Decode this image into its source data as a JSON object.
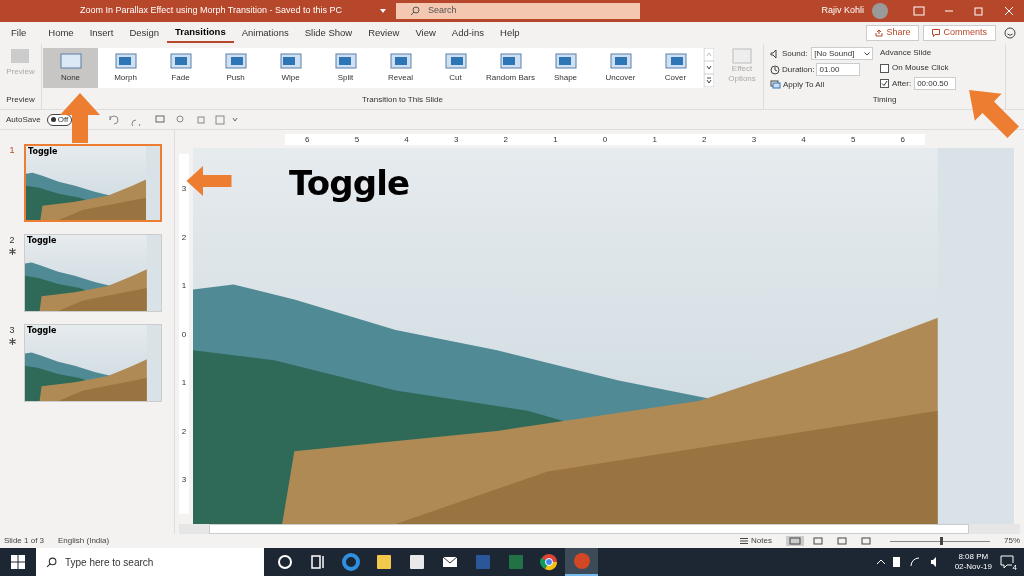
{
  "title_bar": {
    "document_title": "Zoom In Parallax Effect using Morph Transition  -  Saved to this PC",
    "search_placeholder": "Search",
    "user": "Rajiv Kohli"
  },
  "menu_tabs": [
    {
      "label": "File",
      "selected": false
    },
    {
      "label": "Home",
      "selected": false
    },
    {
      "label": "Insert",
      "selected": false
    },
    {
      "label": "Design",
      "selected": false
    },
    {
      "label": "Transitions",
      "selected": true
    },
    {
      "label": "Animations",
      "selected": false
    },
    {
      "label": "Slide Show",
      "selected": false
    },
    {
      "label": "Review",
      "selected": false
    },
    {
      "label": "View",
      "selected": false
    },
    {
      "label": "Add-ins",
      "selected": false
    },
    {
      "label": "Help",
      "selected": false
    }
  ],
  "share": "Share",
  "comments": "Comments",
  "ribbon": {
    "preview": {
      "label": "Preview",
      "disabled": true
    },
    "preview_group": "Preview",
    "transition_group": "Transition to This Slide",
    "transitions": [
      {
        "label": "None",
        "selected": true
      },
      {
        "label": "Morph",
        "selected": false
      },
      {
        "label": "Fade",
        "selected": false
      },
      {
        "label": "Push",
        "selected": false
      },
      {
        "label": "Wipe",
        "selected": false
      },
      {
        "label": "Split",
        "selected": false
      },
      {
        "label": "Reveal",
        "selected": false
      },
      {
        "label": "Cut",
        "selected": false
      },
      {
        "label": "Random Bars",
        "selected": false
      },
      {
        "label": "Shape",
        "selected": false
      },
      {
        "label": "Uncover",
        "selected": false
      },
      {
        "label": "Cover",
        "selected": false
      }
    ],
    "effect_options": {
      "label": "Effect Options",
      "disabled": true
    },
    "timing": {
      "sound_label": "Sound:",
      "sound_value": "[No Sound]",
      "duration_label": "Duration:",
      "duration_value": "01.00",
      "apply_all": "Apply To All",
      "advance_slide": "Advance Slide",
      "on_mouse_click": {
        "label": "On Mouse Click",
        "checked": false
      },
      "after": {
        "label": "After:",
        "checked": true,
        "value": "00:00.50"
      },
      "group": "Timing"
    }
  },
  "quick_access": {
    "autosave_label": "AutoSave",
    "autosave_state": "Off",
    "autosave_on": false
  },
  "horizontal_ruler": [
    "6",
    "5",
    "4",
    "3",
    "2",
    "1",
    "0",
    "1",
    "2",
    "3",
    "4",
    "5",
    "6"
  ],
  "vertical_ruler": [
    "3",
    "2",
    "1",
    "0",
    "1",
    "2",
    "3"
  ],
  "slides": [
    {
      "number": "1",
      "title": "Toggle",
      "selected": true,
      "animated": false
    },
    {
      "number": "2",
      "title": "Toggle",
      "selected": false,
      "animated": true
    },
    {
      "number": "3",
      "title": "Toggle",
      "selected": false,
      "animated": true
    }
  ],
  "slide": {
    "title": "Toggle"
  },
  "status_bar": {
    "slide_info": "Slide 1 of 3",
    "language": "English (India)",
    "notes": "Notes",
    "zoom_slider": {
      "level": 0.5
    },
    "zoom": "75%"
  },
  "taskbar": {
    "search_placeholder": "Type here to search",
    "apps": [
      {
        "kind": "cortana",
        "active": false
      },
      {
        "kind": "taskview",
        "active": false
      },
      {
        "kind": "edge",
        "active": false
      },
      {
        "kind": "explorer",
        "active": false
      },
      {
        "kind": "store",
        "active": false
      },
      {
        "kind": "mail",
        "active": false
      },
      {
        "kind": "word",
        "active": false
      },
      {
        "kind": "excel",
        "active": false
      },
      {
        "kind": "chrome",
        "active": false
      },
      {
        "kind": "powerpoint",
        "active": true
      }
    ],
    "time": "8:08 PM",
    "date": "02-Nov-19",
    "notifications": "4"
  }
}
